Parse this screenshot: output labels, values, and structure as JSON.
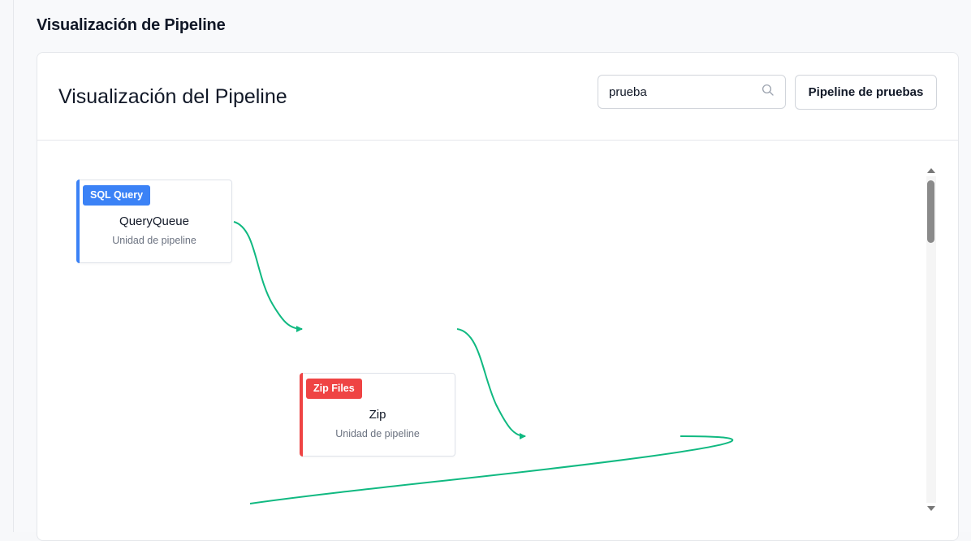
{
  "page": {
    "section_title": "Visualización de Pipeline"
  },
  "card": {
    "title": "Visualización del Pipeline",
    "search": {
      "value": "prueba",
      "icon": "search-icon"
    },
    "pipeline_button_label": "Pipeline de pruebas"
  },
  "nodes": [
    {
      "tag": "SQL Query",
      "name": "QueryQueue",
      "subtitle": "Unidad de pipeline",
      "color": "#3b82f6"
    },
    {
      "tag": "Zip Files",
      "name": "Zip",
      "subtitle": "Unidad de pipeline",
      "color": "#ef4444"
    }
  ],
  "colors": {
    "edge": "#10b981",
    "scrollbar_thumb": "#8a8a8a"
  }
}
